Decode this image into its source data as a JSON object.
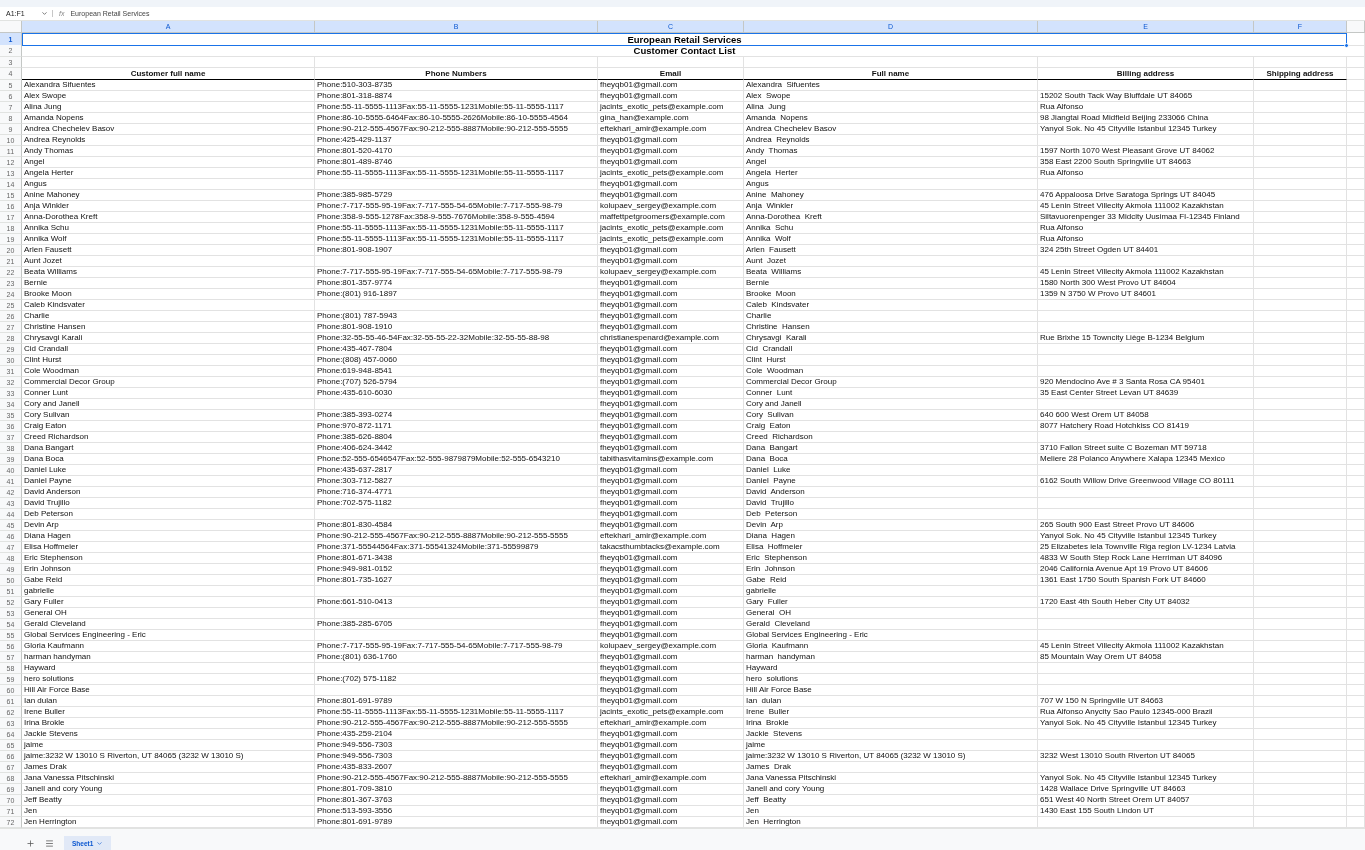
{
  "formula_bar": {
    "name_box": "A1:F1",
    "fx": "fx",
    "content": "European Retail Services"
  },
  "columns": [
    {
      "letter": "A",
      "selected": true
    },
    {
      "letter": "B",
      "selected": true
    },
    {
      "letter": "C",
      "selected": true
    },
    {
      "letter": "D",
      "selected": true
    },
    {
      "letter": "E",
      "selected": true
    },
    {
      "letter": "F",
      "selected": true
    }
  ],
  "title_rows": [
    {
      "row": "1",
      "text": "European Retail Services",
      "selected": true
    },
    {
      "row": "2",
      "text": "Customer Contact List",
      "selected": false
    }
  ],
  "blank_row": "3",
  "header": {
    "row": "4",
    "cells": [
      "Customer full name",
      "Phone Numbers",
      "Email",
      "Full name",
      "Billing address",
      "Shipping address"
    ]
  },
  "rows": [
    {
      "row": "5",
      "name": "Alexandra Sifuentes",
      "phone": "Phone:510-303-8735",
      "email": "fheyqb01@gmail.com",
      "full_name": "Alexandra  Sifuentes"
    },
    {
      "row": "6",
      "name": "Alex Swope",
      "phone": "Phone:801-318-8874",
      "email": "fheyqb01@gmail.com",
      "full_name": "Alex  Swope",
      "billing": "15202 South Tack Way Bluffdale UT 84065"
    },
    {
      "row": "7",
      "name": "Alina Jung",
      "phone": "Phone:55-11-5555-1113Fax:55-11-5555-1231Mobile:55-11-5555-1117",
      "email": "jacints_exotic_pets@example.com",
      "full_name": "Alina  Jung",
      "billing": "Rua Alfonso"
    },
    {
      "row": "8",
      "name": "Amanda Nopens",
      "phone": "Phone:86-10-5555-6464Fax:86-10-5555-2626Mobile:86-10-5555-4564",
      "email": "gina_han@example.com",
      "full_name": "Amanda  Nopens",
      "billing": "98 Jiangtai Road Midfield Beijing 233066 China"
    },
    {
      "row": "9",
      "name": "Andrea Chechelev Basov",
      "phone": "Phone:90-212-555-4567Fax:90-212-555-8887Mobile:90-212-555-5555",
      "email": "eftekhari_amir@example.com",
      "full_name": "Andrea Chechelev Basov",
      "billing": "Yanyol Sok. No 45 Cityville Istanbul 12345 Turkey"
    },
    {
      "row": "10",
      "name": "Andrea Reynolds",
      "phone": "Phone:425-429-1137",
      "email": "fheyqb01@gmail.com",
      "full_name": "Andrea  Reynolds"
    },
    {
      "row": "11",
      "name": "Andy Thomas",
      "phone": "Phone:801-520-4170",
      "email": "fheyqb01@gmail.com",
      "full_name": "Andy  Thomas",
      "billing": "1597 North 1070 West Pleasant Grove UT 84062"
    },
    {
      "row": "12",
      "name": "Angel",
      "phone": "Phone:801-489-8746",
      "email": "fheyqb01@gmail.com",
      "full_name": "Angel",
      "billing": "358 East 2200 South Springville UT 84663"
    },
    {
      "row": "13",
      "name": "Angela Herter",
      "phone": "Phone:55-11-5555-1113Fax:55-11-5555-1231Mobile:55-11-5555-1117",
      "email": "jacints_exotic_pets@example.com",
      "full_name": "Angela  Herter",
      "billing": "Rua Alfonso"
    },
    {
      "row": "14",
      "name": "Angus",
      "email": "fheyqb01@gmail.com",
      "full_name": "Angus"
    },
    {
      "row": "15",
      "name": "Anine Mahoney",
      "phone": "Phone:385-985-5729",
      "email": "fheyqb01@gmail.com",
      "full_name": "Anine  Mahoney",
      "billing": "476 Appaloosa Drive Saratoga Springs UT 84045"
    },
    {
      "row": "16",
      "name": "Anja Winkler",
      "phone": "Phone:7-717-555-95-19Fax:7-717-555-54-65Mobile:7-717-555-98-79",
      "email": "kolupaev_sergey@example.com",
      "full_name": "Anja  Winkler",
      "billing": "45 Lenin Street Villecity Akmola 111002 Kazakhstan"
    },
    {
      "row": "17",
      "name": "Anna-Dorothea Kreft",
      "phone": "Phone:358-9-555-1278Fax:358-9-555-7676Mobile:358-9-555-4594",
      "email": "maffettpetgroomers@example.com",
      "full_name": "Anna-Dorothea  Kreft",
      "billing": "Siltavuorenpenger 33 Midcity Uusimaa FI-12345 Finland"
    },
    {
      "row": "18",
      "name": "Annika Schu",
      "phone": "Phone:55-11-5555-1113Fax:55-11-5555-1231Mobile:55-11-5555-1117",
      "email": "jacints_exotic_pets@example.com",
      "full_name": "Annika  Schu",
      "billing": "Rua Alfonso"
    },
    {
      "row": "19",
      "name": "Annika Wolf",
      "phone": "Phone:55-11-5555-1113Fax:55-11-5555-1231Mobile:55-11-5555-1117",
      "email": "jacints_exotic_pets@example.com",
      "full_name": "Annika  Wolf",
      "billing": "Rua Alfonso"
    },
    {
      "row": "20",
      "name": "Arlen Fausett",
      "phone": "Phone:801-908-1907",
      "email": "fheyqb01@gmail.com",
      "full_name": "Arlen  Fausett",
      "billing": "324 25th Street Ogden UT 84401"
    },
    {
      "row": "21",
      "name": "Aunt Jozet",
      "email": "fheyqb01@gmail.com",
      "full_name": "Aunt  Jozet"
    },
    {
      "row": "22",
      "name": "Beata Williams",
      "phone": "Phone:7-717-555-95-19Fax:7-717-555-54-65Mobile:7-717-555-98-79",
      "email": "kolupaev_sergey@example.com",
      "full_name": "Beata  Williams",
      "billing": "45 Lenin Street Villecity Akmola 111002 Kazakhstan"
    },
    {
      "row": "23",
      "name": "Bernie",
      "phone": "Phone:801-357-9774",
      "email": "fheyqb01@gmail.com",
      "full_name": "Bernie",
      "billing": "1580 North 300 West Provo UT 84604"
    },
    {
      "row": "24",
      "name": "Brooke Moon",
      "phone": "Phone:(801) 916-1897",
      "email": "fheyqb01@gmail.com",
      "full_name": "Brooke  Moon",
      "billing": "1359 N 3750 W Provo UT 84601"
    },
    {
      "row": "25",
      "name": "Caleb Kindsvater",
      "email": "fheyqb01@gmail.com",
      "full_name": "Caleb  Kindsvater"
    },
    {
      "row": "26",
      "name": "Charlie",
      "phone": "Phone:(801) 787-5943",
      "email": "fheyqb01@gmail.com",
      "full_name": "Charlie"
    },
    {
      "row": "27",
      "name": "Christine Hansen",
      "phone": "Phone:801-908-1910",
      "email": "fheyqb01@gmail.com",
      "full_name": "Christine  Hansen"
    },
    {
      "row": "28",
      "name": "Chrysavgi Karali",
      "phone": "Phone:32-55-55-46-54Fax:32-55-55-22-32Mobile:32-55-55-88-98",
      "email": "christianespenard@example.com",
      "full_name": "Chrysavgi  Karali",
      "billing": "Rue Brixhe 15 Towncity Liège B-1234 Belgium"
    },
    {
      "row": "29",
      "name": "Cid Crandall",
      "phone": "Phone:435-467-7804",
      "email": "fheyqb01@gmail.com",
      "full_name": "Cid  Crandall"
    },
    {
      "row": "30",
      "name": "Clint Hurst",
      "phone": "Phone:(808) 457-0060",
      "email": "fheyqb01@gmail.com",
      "full_name": "Clint  Hurst"
    },
    {
      "row": "31",
      "name": "Cole Woodman",
      "phone": "Phone:619-948-8541",
      "email": "fheyqb01@gmail.com",
      "full_name": "Cole  Woodman"
    },
    {
      "row": "32",
      "name": "Commercial Decor Group",
      "phone": "Phone:(707) 526-5794",
      "email": "fheyqb01@gmail.com",
      "full_name": "Commercial Decor Group",
      "billing": "920 Mendocino Ave # 3 Santa Rosa CA 95401"
    },
    {
      "row": "33",
      "name": "Conner Lunt",
      "phone": "Phone:435-610-6030",
      "email": "fheyqb01@gmail.com",
      "full_name": "Conner  Lunt",
      "billing": "35 East Center Street Levan UT 84639"
    },
    {
      "row": "34",
      "name": "Cory and Janell",
      "email": "fheyqb01@gmail.com",
      "full_name": "Cory and Janell"
    },
    {
      "row": "35",
      "name": "Cory Sulivan",
      "phone": "Phone:385-393-0274",
      "email": "fheyqb01@gmail.com",
      "full_name": "Cory  Sulivan",
      "billing": "640 600 West Orem UT 84058"
    },
    {
      "row": "36",
      "name": "Craig Eaton",
      "phone": "Phone:970-872-1171",
      "email": "fheyqb01@gmail.com",
      "full_name": "Craig  Eaton",
      "billing": "8077 Hatchery Road Hotchkiss CO 81419"
    },
    {
      "row": "37",
      "name": "Creed Richardson",
      "phone": "Phone:385-626-8804",
      "email": "fheyqb01@gmail.com",
      "full_name": "Creed  Richardson"
    },
    {
      "row": "38",
      "name": "Dana Bangart",
      "phone": "Phone:406-624-3442",
      "email": "fheyqb01@gmail.com",
      "full_name": "Dana  Bangart",
      "billing": "3710 Fallon Street suite C Bozeman MT 59718"
    },
    {
      "row": "39",
      "name": "Dana Boca",
      "phone": "Phone:52-555-6546547Fax:52-555-9879879Mobile:52-555-6543210",
      "email": "tabithasvitamins@example.com",
      "full_name": "Dana  Boca",
      "billing": "Meliere 28 Polanco Anywhere Xalapa 12345 Mexico"
    },
    {
      "row": "40",
      "name": "Daniel Luke",
      "phone": "Phone:435-637-2817",
      "email": "fheyqb01@gmail.com",
      "full_name": "Daniel  Luke"
    },
    {
      "row": "41",
      "name": "Daniel Payne",
      "phone": "Phone:303-712-5827",
      "email": "fheyqb01@gmail.com",
      "full_name": "Daniel  Payne",
      "billing": "6162 South Willow Drive Greenwood Village CO 80111"
    },
    {
      "row": "42",
      "name": "David Anderson",
      "phone": "Phone:716-374-4771",
      "email": "fheyqb01@gmail.com",
      "full_name": "David  Anderson"
    },
    {
      "row": "43",
      "name": "David Trujillo",
      "phone": "Phone:702-575-1182",
      "email": "fheyqb01@gmail.com",
      "full_name": "David  Trujillo"
    },
    {
      "row": "44",
      "name": "Deb Peterson",
      "email": "fheyqb01@gmail.com",
      "full_name": "Deb  Peterson"
    },
    {
      "row": "45",
      "name": "Devin Arp",
      "phone": "Phone:801-830-4584",
      "email": "fheyqb01@gmail.com",
      "full_name": "Devin  Arp",
      "billing": "265 South 900 East Street Provo UT 84606"
    },
    {
      "row": "46",
      "name": "Diana Hagen",
      "phone": "Phone:90-212-555-4567Fax:90-212-555-8887Mobile:90-212-555-5555",
      "email": "eftekhari_amir@example.com",
      "full_name": "Diana  Hagen",
      "billing": "Yanyol Sok. No 45 Cityville Istanbul 12345 Turkey"
    },
    {
      "row": "47",
      "name": "Elisa Hoffmeier",
      "phone": "Phone:371-55544564Fax:371-55541324Mobile:371-55599879",
      "email": "takacsthumbtacks@example.com",
      "full_name": "Elisa  Hoffmeier",
      "billing": "25 Elizabetes iela Townville Riga region LV-1234 Latvia"
    },
    {
      "row": "48",
      "name": "Eric Stephenson",
      "phone": "Phone:801-671-3438",
      "email": "fheyqb01@gmail.com",
      "full_name": "Eric  Stephenson",
      "billing": "4833 W South Step Rock Lane Herriman UT 84096"
    },
    {
      "row": "49",
      "name": "Erin Johnson",
      "phone": "Phone:949-981-0152",
      "email": "fheyqb01@gmail.com",
      "full_name": "Erin  Johnson",
      "billing": "2046 California Avenue Apt 19 Provo UT 84606"
    },
    {
      "row": "50",
      "name": "Gabe Reid",
      "phone": "Phone:801-735-1627",
      "email": "fheyqb01@gmail.com",
      "full_name": "Gabe  Reid",
      "billing": "1361 East 1750 South Spanish Fork UT 84660"
    },
    {
      "row": "51",
      "name": "gabrielle",
      "email": "fheyqb01@gmail.com",
      "full_name": "gabrielle"
    },
    {
      "row": "52",
      "name": "Gary Fuller",
      "phone": "Phone:661-510-0413",
      "email": "fheyqb01@gmail.com",
      "full_name": "Gary  Fuller",
      "billing": "1720 East 4th South Heber City UT 84032"
    },
    {
      "row": "53",
      "name": "General OH",
      "email": "fheyqb01@gmail.com",
      "full_name": "General  OH"
    },
    {
      "row": "54",
      "name": "Gerald Cleveland",
      "phone": "Phone:385-285-6705",
      "email": "fheyqb01@gmail.com",
      "full_name": "Gerald  Cleveland"
    },
    {
      "row": "55",
      "name": "Global Services Engineering - Eric",
      "email": "fheyqb01@gmail.com",
      "full_name": "Global Services Engineering - Eric"
    },
    {
      "row": "56",
      "name": "Gloria Kaufmann",
      "phone": "Phone:7-717-555-95-19Fax:7-717-555-54-65Mobile:7-717-555-98-79",
      "email": "kolupaev_sergey@example.com",
      "full_name": "Gloria  Kaufmann",
      "billing": "45 Lenin Street Villecity Akmola 111002 Kazakhstan"
    },
    {
      "row": "57",
      "name": "harman handyman",
      "phone": "Phone:(801) 636-1760",
      "email": "fheyqb01@gmail.com",
      "full_name": "harman  handyman",
      "billing": "85 Mountain Way Orem UT 84058"
    },
    {
      "row": "58",
      "name": "Hayward",
      "email": "fheyqb01@gmail.com",
      "full_name": "Hayward"
    },
    {
      "row": "59",
      "name": "hero solutions",
      "phone": "Phone:(702) 575-1182",
      "email": "fheyqb01@gmail.com",
      "full_name": "hero  solutions"
    },
    {
      "row": "60",
      "name": "Hill Air Force Base",
      "email": "fheyqb01@gmail.com",
      "full_name": "Hill Air Force Base"
    },
    {
      "row": "61",
      "name": "Ian dulan",
      "phone": "Phone:801-691-9789",
      "email": "fheyqb01@gmail.com",
      "full_name": "Ian  dulan",
      "billing": "707 W 150 N Springville UT 84663"
    },
    {
      "row": "62",
      "name": "Irene Buller",
      "phone": "Phone:55-11-5555-1113Fax:55-11-5555-1231Mobile:55-11-5555-1117",
      "email": "jacints_exotic_pets@example.com",
      "full_name": "Irene  Buller",
      "billing": "Rua Alfonso Anycity Sao Paulo 12345-000 Brazil"
    },
    {
      "row": "63",
      "name": "Irina Brokle",
      "phone": "Phone:90-212-555-4567Fax:90-212-555-8887Mobile:90-212-555-5555",
      "email": "eftekhari_amir@example.com",
      "full_name": "Irina  Brokle",
      "billing": "Yanyol Sok. No 45 Cityville Istanbul 12345 Turkey"
    },
    {
      "row": "64",
      "name": "Jackie Stevens",
      "phone": "Phone:435-259-2104",
      "email": "fheyqb01@gmail.com",
      "full_name": "Jackie  Stevens"
    },
    {
      "row": "65",
      "name": "jaime",
      "phone": "Phone:949-556-7303",
      "email": "fheyqb01@gmail.com",
      "full_name": "jaime"
    },
    {
      "row": "66",
      "name": "jaime:3232 W 13010 S Riverton, UT 84065 (3232 W 13010 S)",
      "phone": "Phone:949-556-7303",
      "email": "fheyqb01@gmail.com",
      "full_name": "jaime:3232 W 13010 S Riverton, UT 84065 (3232 W 13010 S)",
      "billing": "3232 West 13010 South Riverton UT 84065"
    },
    {
      "row": "67",
      "name": "James Drak",
      "phone": "Phone:435-833-2607",
      "email": "fheyqb01@gmail.com",
      "full_name": "James  Drak"
    },
    {
      "row": "68",
      "name": "Jana Vanessa Pitschinski",
      "phone": "Phone:90-212-555-4567Fax:90-212-555-8887Mobile:90-212-555-5555",
      "email": "eftekhari_amir@example.com",
      "full_name": "Jana Vanessa Pitschinski",
      "billing": "Yanyol Sok. No 45 Cityville Istanbul 12345 Turkey"
    },
    {
      "row": "69",
      "name": "Janell and cory Young",
      "phone": "Phone:801-709-3810",
      "email": "fheyqb01@gmail.com",
      "full_name": "Janell and cory Young",
      "billing": "1428 Wallace Drive Springville UT 84663"
    },
    {
      "row": "70",
      "name": "Jeff Beatty",
      "phone": "Phone:801-367-3763",
      "email": "fheyqb01@gmail.com",
      "full_name": "Jeff  Beatty",
      "billing": "651 West 40 North Street Orem UT 84057"
    },
    {
      "row": "71",
      "name": "Jen",
      "phone": "Phone:513-593-3556",
      "email": "fheyqb01@gmail.com",
      "full_name": "Jen",
      "billing": "1430 East 155 South Lindon UT"
    },
    {
      "row": "72",
      "name": "Jen Herrington",
      "phone": "Phone:801-691-9789",
      "email": "fheyqb01@gmail.com",
      "full_name": "Jen  Herrington"
    }
  ],
  "sheets": [
    {
      "label": "Sheet1",
      "selected": true
    }
  ]
}
